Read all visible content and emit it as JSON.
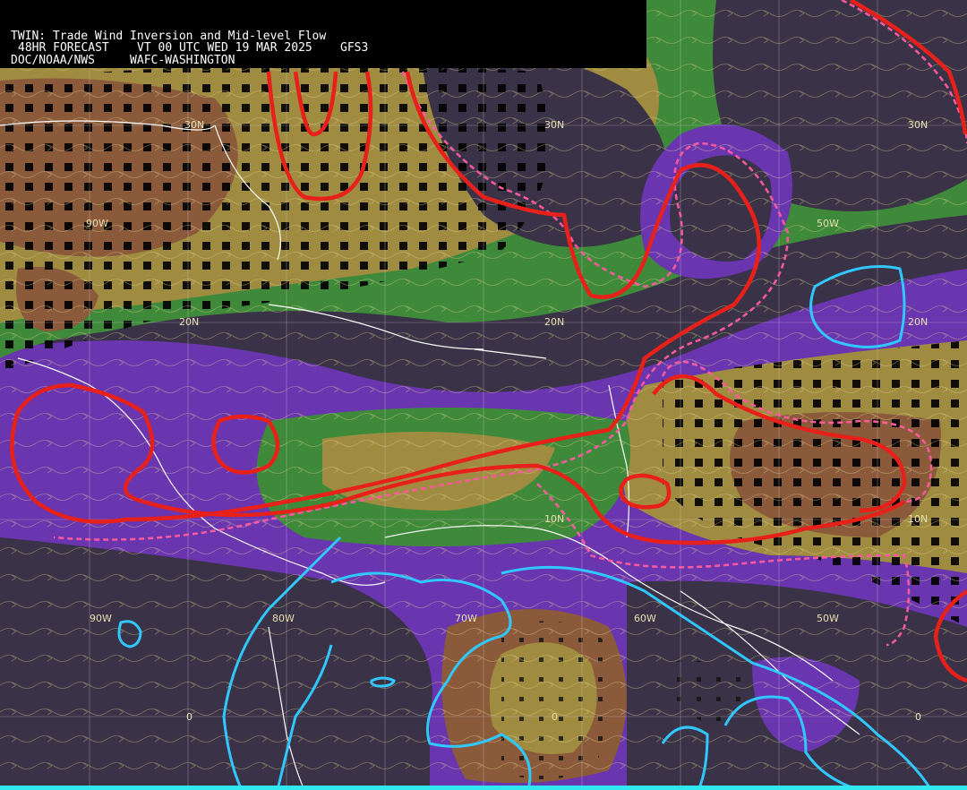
{
  "header": {
    "title": "TWIN: Trade Wind Inversion and Mid-level Flow",
    "forecast": "48HR FORECAST    VT 00 UTC WED 19 MAR 2025    GFS3",
    "agency": "DOC/NOAA/NWS     WAFC-WASHINGTON"
  },
  "grid_labels": {
    "lat30_left": "30N",
    "lat30_center": "30N",
    "lat30_right": "30N",
    "lon90_top": "90W",
    "lon50_top": "50W",
    "lat20_left": "20N",
    "lat20_center": "20N",
    "lat20_right": "20N",
    "lat10_center": "10N",
    "lat10_right": "10N",
    "lon90_bottom": "90W",
    "lon80_bottom": "80W",
    "lon70_bottom": "70W",
    "lon60_bottom": "60W",
    "lon50_bottom": "50W",
    "eq_left": "0",
    "eq_center": "0",
    "eq_right": "0"
  },
  "colors": {
    "background_dark": "#3a3247",
    "purple": "#7a3ec8",
    "green": "#3f8a3a",
    "olive": "#a08c40",
    "brown": "#8a5a3a",
    "red_contour": "#e8201a",
    "pink_dashed": "#ff5aa0",
    "cyan_contour": "#30c8ff",
    "streamline": "#e8d890",
    "coastline": "#ffffff"
  }
}
